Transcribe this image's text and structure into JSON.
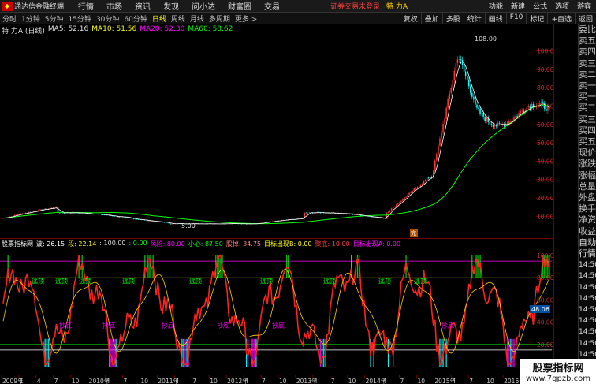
{
  "titlebar": {
    "app_name": "通达信金融终端",
    "menus": [
      "行情",
      "市场",
      "资讯",
      "发现",
      "问小达",
      "财富圈",
      "交易"
    ],
    "status": "证券交易未登录",
    "stock_name": "特 力A",
    "right_items": [
      "功能",
      "新建",
      "公式",
      "选项",
      "游客"
    ]
  },
  "toolbar": {
    "timeframes": [
      "分时",
      "1分钟",
      "5分钟",
      "15分钟",
      "30分钟",
      "60分钟",
      "日线",
      "周线",
      "月线",
      "多周期",
      "更多 >"
    ],
    "active_index": 6,
    "tools": [
      "复权",
      "叠加",
      "多股",
      "统计",
      "画线",
      "F10",
      "标记",
      "+自选",
      "返回"
    ]
  },
  "main_header": {
    "stock": "特 力A (日线)",
    "ma5": "MA5: 52.16",
    "ma10": "MA10: 51.56",
    "ma20": "MA20: 52.30",
    "ma60": "MA60: 58.62"
  },
  "price_axis": {
    "labels": [
      "100.0",
      "90.00",
      "80.00",
      "70.00",
      "60.00",
      "50.00",
      "40.00",
      "30.00",
      "20.00",
      "10.00"
    ],
    "values": [
      100,
      90,
      80,
      70,
      60,
      50,
      40,
      30,
      20,
      10
    ],
    "high_mark": "108.00",
    "low_mark": "5.00",
    "flag": "完"
  },
  "sub_header": {
    "name": "股票指标网",
    "v1": "波: 26.15",
    "v2": "段: 22.14",
    "v3": ": 100.00",
    "v4": ": 0.00",
    "v5": "风险: 80.00",
    "v6": "小心: 87.50",
    "v7": "股掉: 34.75",
    "v8": "目标出现B: 0.00",
    "v9": "聚底: 10.00",
    "v10": "目标出现A: 0.00"
  },
  "sub_axis": {
    "labels": [
      "100.0",
      "80.00",
      "60.00",
      "40.00",
      "20.00"
    ],
    "values": [
      100,
      80,
      60,
      40,
      20
    ],
    "current": "48.06"
  },
  "date_axis": {
    "labels": [
      "2009年",
      "1",
      "4",
      "7",
      "10",
      "2010年",
      "4",
      "7",
      "10",
      "2011年",
      "4",
      "7",
      "10",
      "2012年",
      "4",
      "7",
      "10",
      "2013年",
      "4",
      "7",
      "10",
      "2014年",
      "4",
      "7",
      "10",
      "2015年",
      "4",
      "7",
      "10",
      "2016年",
      "4"
    ]
  },
  "sidebar": {
    "items": [
      "委比",
      "卖五",
      "卖四",
      "卖三",
      "卖二",
      "卖一",
      "买一",
      "买二",
      "买三",
      "买四",
      "买五",
      "现价",
      "涨跌",
      "涨幅",
      "总量",
      "外盘",
      "换手",
      "净资",
      "收益",
      "自动",
      "行情",
      "14:50",
      "14:50",
      "14:50",
      "14:50",
      "14:50",
      "14:50",
      "14:50",
      "14:50",
      "14:50"
    ]
  },
  "signal_labels": [
    "逃顶",
    "逃顶",
    "逃顶",
    "逃顶",
    "逃顶",
    "逃顶",
    "逃顶",
    "逃顶",
    "逃顶",
    "抄底",
    "抄底",
    "抄底",
    "抄底",
    "抄底",
    "抄底"
  ],
  "watermark": {
    "line1": "股票指标网",
    "line2": "www.7gpzb.com"
  },
  "colors": {
    "up": "#ff3030",
    "down": "#00ffff",
    "ma5": "#ffffff",
    "ma10": "#ffff00",
    "ma20": "#ff00ff",
    "ma60": "#00ff00"
  }
}
